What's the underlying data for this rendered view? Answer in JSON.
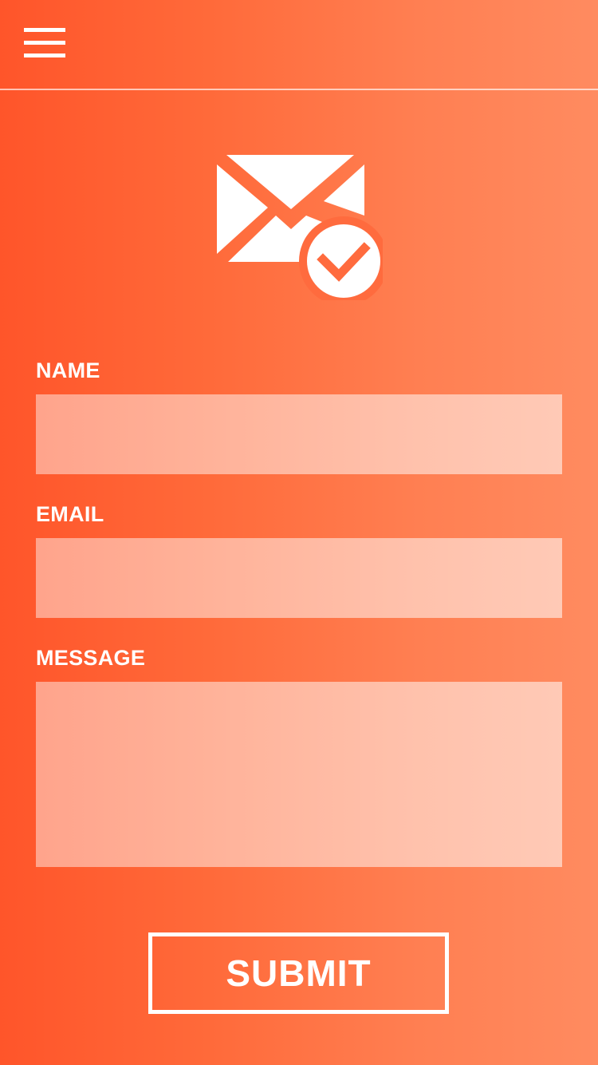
{
  "header": {
    "menu_icon": "hamburger-menu-icon"
  },
  "hero": {
    "icon": "mail-check-icon"
  },
  "form": {
    "name_label": "NAME",
    "name_value": "",
    "email_label": "EMAIL",
    "email_value": "",
    "message_label": "MESSAGE",
    "message_value": "",
    "submit_label": "SUBMIT"
  },
  "colors": {
    "gradient_start": "#ff552a",
    "gradient_end": "#ff8b60",
    "foreground": "#ffffff"
  }
}
